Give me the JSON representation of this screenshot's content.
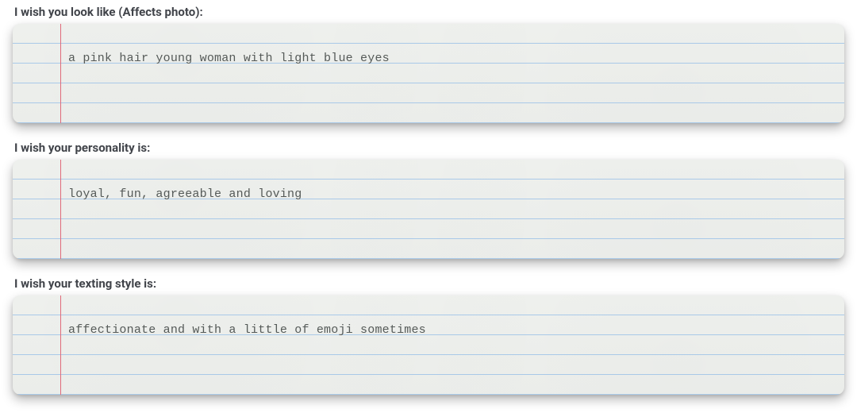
{
  "fields": [
    {
      "label": "I wish you look like (Affects photo):",
      "value": "a pink hair young woman with light blue eyes"
    },
    {
      "label": "I wish your personality is:",
      "value": "loyal, fun, agreeable and loving"
    },
    {
      "label": "I wish your texting style is:",
      "value": "affectionate and with a little of emoji sometimes"
    }
  ]
}
